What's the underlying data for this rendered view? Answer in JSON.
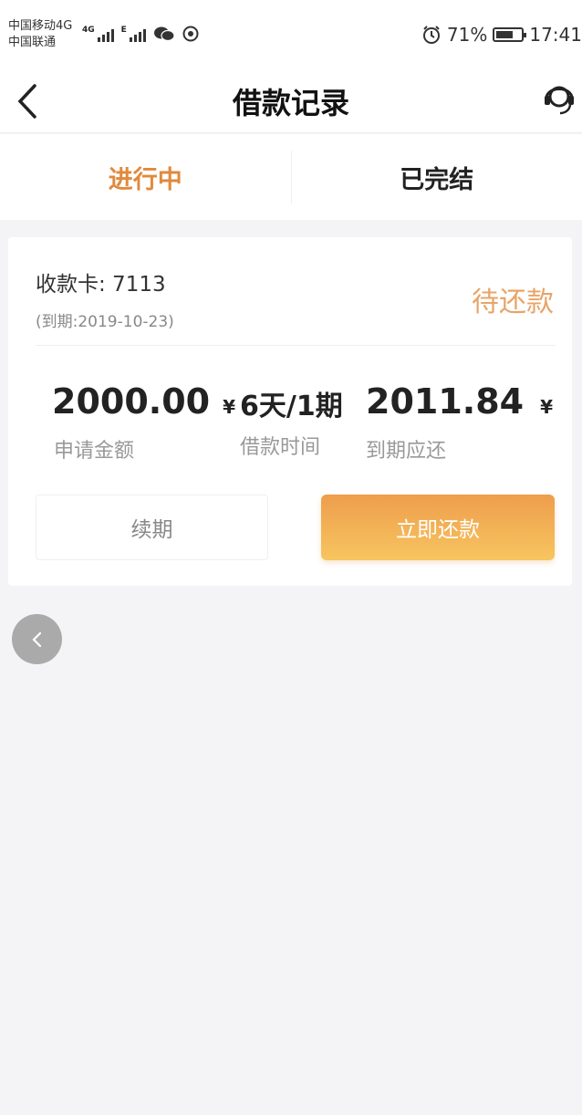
{
  "status_bar": {
    "carrier_1": "中国移动4G",
    "carrier_2": "中国联通",
    "net_1": "4G",
    "net_2": "E",
    "battery_percent": "71%",
    "battery_level": 0.71,
    "time": "17:41",
    "icons": [
      "signal-icon",
      "wechat-icon",
      "app-icon",
      "alarm-icon",
      "battery-icon"
    ]
  },
  "header": {
    "title": "借款记录",
    "back_icon": "chevron-left-icon",
    "service_icon": "customer-service-icon"
  },
  "tabs": [
    {
      "label": "进行中",
      "active": true
    },
    {
      "label": "已完结",
      "active": false
    }
  ],
  "loan": {
    "card_label": "收款卡: 7113",
    "due_date": "(到期:2019-10-23)",
    "status": "待还款",
    "amount_value": "2000.00",
    "currency": "¥",
    "amount_label": "申请金额",
    "term_value": "6天/1期",
    "term_label": "借款时间",
    "due_value": "2011.84",
    "due_label": "到期应还",
    "renew_label": "续期",
    "repay_label": "立即还款"
  },
  "colors": {
    "accent": "#e08a3d",
    "status": "#e8a468",
    "button_gradient_top": "#ee9e4c",
    "button_gradient_bottom": "#f7c560",
    "background": "#f4f4f6"
  }
}
